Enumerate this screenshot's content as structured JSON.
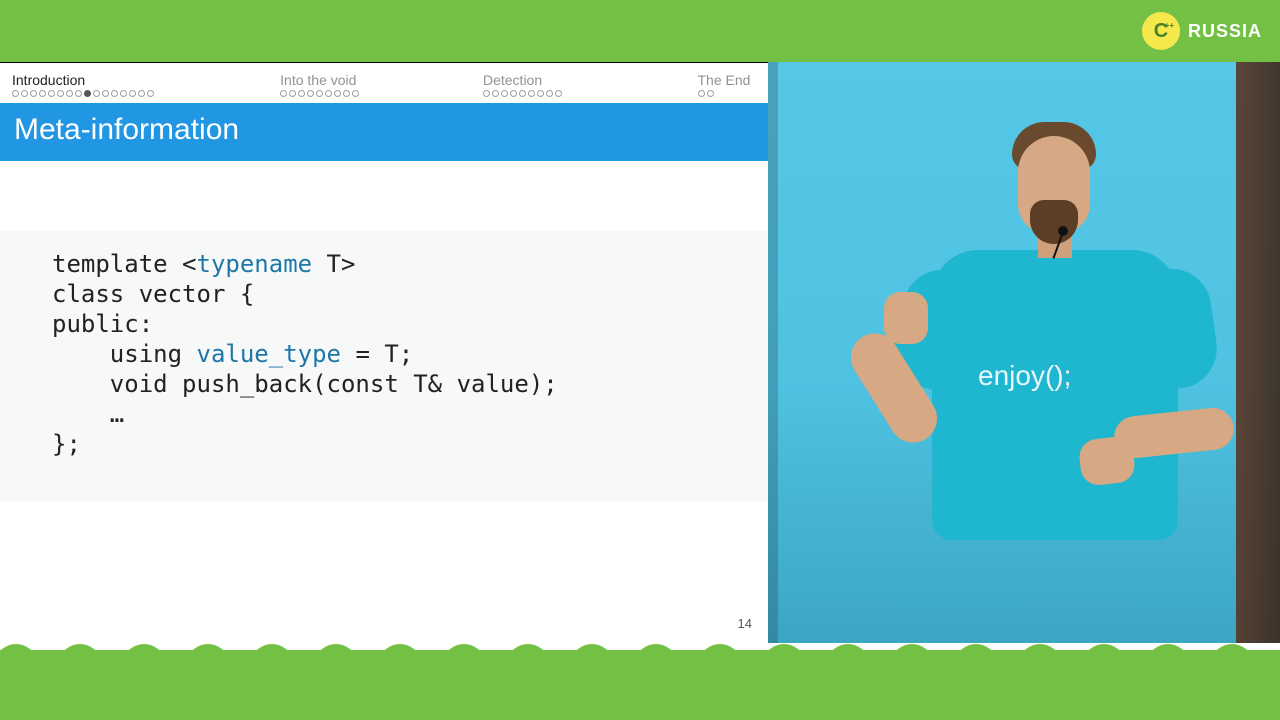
{
  "brand": {
    "logo_letter": "C",
    "logo_plus": "++",
    "name": "RUSSIA"
  },
  "slide": {
    "nav": {
      "sections": [
        {
          "label": "Introduction",
          "dots": 16,
          "current": 8,
          "active": true
        },
        {
          "label": "Into the void",
          "dots": 9,
          "current": -1,
          "active": false
        },
        {
          "label": "Detection",
          "dots": 9,
          "current": -1,
          "active": false
        },
        {
          "label": "The End",
          "dots": 2,
          "current": -1,
          "active": false
        }
      ]
    },
    "title": "Meta-information",
    "code": {
      "l1a": "template <",
      "l1b": "typename",
      "l1c": " T>",
      "l2": "class vector {",
      "l3": "public:",
      "l4a": "    using ",
      "l4b": "value_type",
      "l4c": " = T;",
      "l5": "",
      "l6": "    void push_back(const T& value);",
      "l7": "",
      "l8": "    …",
      "l9": "};"
    },
    "page_number": "14"
  },
  "speaker": {
    "shirt_word": "enjoy",
    "shirt_paren": "();"
  }
}
